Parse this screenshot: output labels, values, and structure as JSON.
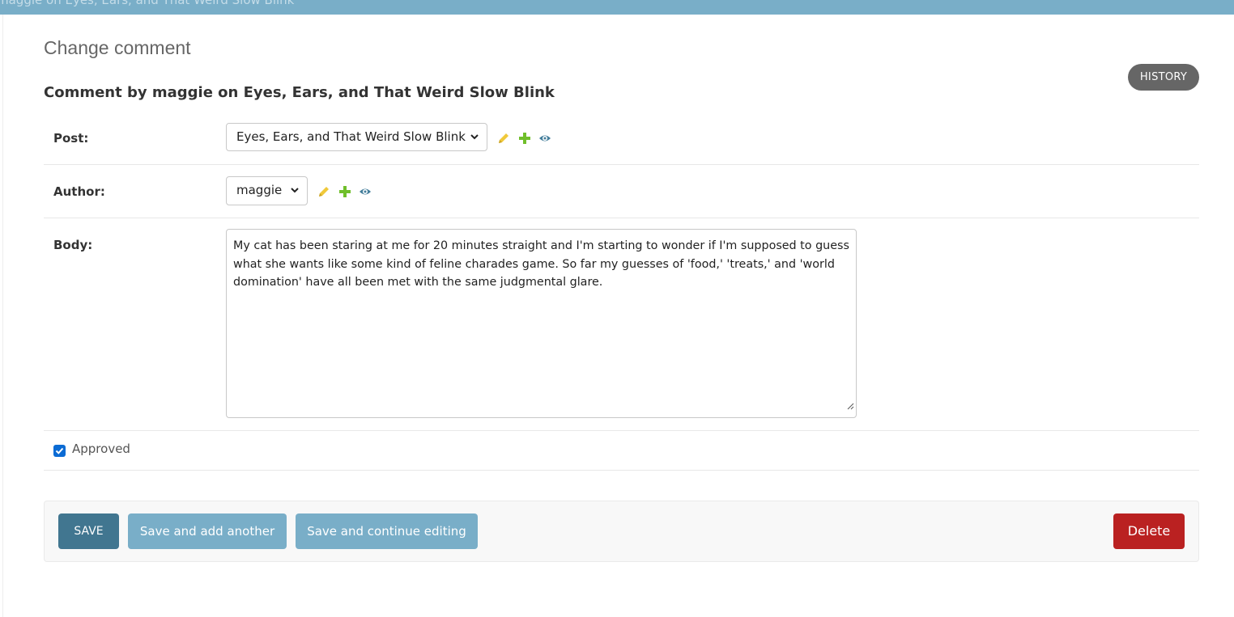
{
  "topbar": {
    "breadcrumb_tail": "maggie on Eyes, Ears, and That Weird Slow Blink"
  },
  "page": {
    "heading": "Change comment",
    "object_title": "Comment by maggie on Eyes, Ears, and That Weird Slow Blink",
    "history_label": "HISTORY"
  },
  "form": {
    "post": {
      "label": "Post:",
      "selected": "Eyes, Ears, and That Weird Slow Blink"
    },
    "author": {
      "label": "Author:",
      "selected": "maggie"
    },
    "body": {
      "label": "Body:",
      "value": "My cat has been staring at me for 20 minutes straight and I'm starting to wonder if I'm supposed to guess what she wants like some kind of feline charades game. So far my guesses of 'food,' 'treats,' and 'world domination' have all been met with the same judgmental glare."
    },
    "approved": {
      "label": "Approved",
      "checked": true
    }
  },
  "submit": {
    "save_label": "SAVE",
    "save_add_another_label": "Save and add another",
    "save_continue_label": "Save and continue editing",
    "delete_label": "Delete"
  },
  "icons": {
    "edit": "pencil-icon",
    "add": "plus-icon",
    "view": "eye-icon",
    "chevron": "chevron-down-icon"
  },
  "colors": {
    "header": "#79aec8",
    "save_button": "#417690",
    "secondary_button": "#79aec8",
    "delete_button": "#ba2121",
    "history_button": "#666666",
    "edit_icon": "#f0c93a",
    "add_icon": "#70bf2b",
    "view_icon": "#447e9b"
  }
}
